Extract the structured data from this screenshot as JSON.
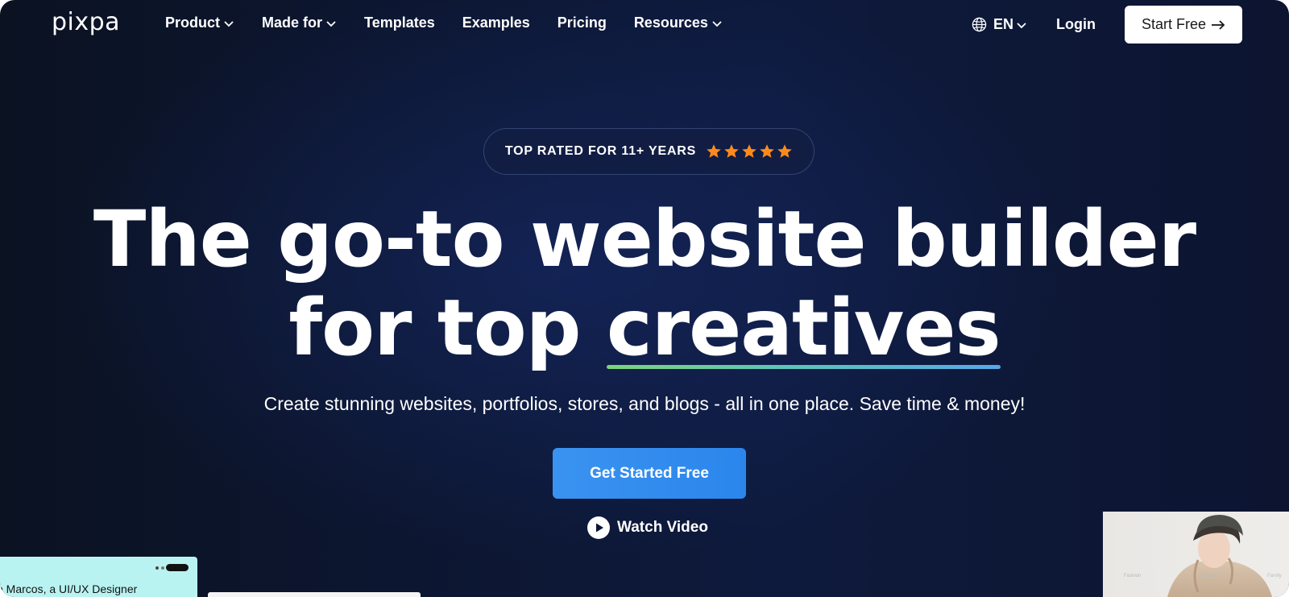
{
  "nav": {
    "logo": "pixpa",
    "links": [
      {
        "label": "Product",
        "dropdown": true
      },
      {
        "label": "Made for",
        "dropdown": true
      },
      {
        "label": "Templates",
        "dropdown": false
      },
      {
        "label": "Examples",
        "dropdown": false
      },
      {
        "label": "Pricing",
        "dropdown": false
      },
      {
        "label": "Resources",
        "dropdown": true
      }
    ],
    "language": "EN",
    "login": "Login",
    "start_free": "Start Free"
  },
  "badge": {
    "text": "TOP RATED FOR 11+ YEARS",
    "stars": 5,
    "star_color": "#ff8a1c"
  },
  "hero": {
    "headline_line1": "The go-to website builder",
    "headline_line2_prefix": "for top ",
    "headline_line2_highlight": "creatives",
    "subtitle": "Create stunning websites, portfolios, stores, and blogs - all in one place. Save time & money!",
    "cta": "Get Started Free",
    "watch_video": "Watch Video"
  },
  "previews": {
    "left_card_text": "o Marcos, a UI/UX Designer",
    "right_card_words": [
      "Fashion",
      "Portraits",
      "Family"
    ]
  },
  "colors": {
    "cta_blue": "#2f8cf0",
    "underline_start": "#7ed37a",
    "underline_end": "#57a8e8",
    "left_card_bg": "#b9f3f1"
  }
}
